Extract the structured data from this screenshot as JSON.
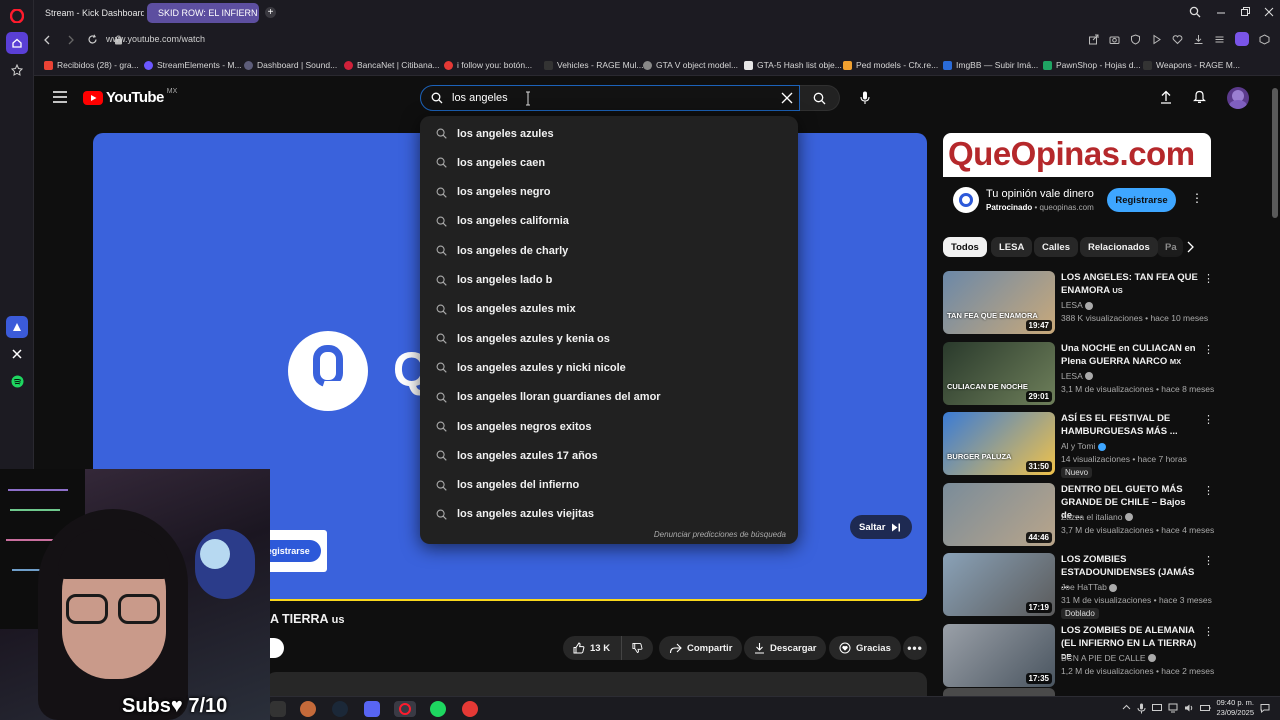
{
  "browser": {
    "tabs": [
      {
        "label": "Stream - Kick Dashboard",
        "active": false
      },
      {
        "label": "SKID ROW: EL INFIERN",
        "active": true
      }
    ],
    "url": "www.youtube.com/watch",
    "bookmarks": [
      "Recibidos (28) - gra...",
      "StreamElements - M...",
      "Dashboard | Sound...",
      "BancaNet | Citibana...",
      "i follow you: botón...",
      "Vehicles - RAGE Mul...",
      "GTA V object model...",
      "GTA-5 Hash list obje...",
      "Ped models - Cfx.re...",
      "ImgBB — Subir Imá...",
      "PawnShop - Hojas d...",
      "Weapons - RAGE M..."
    ]
  },
  "youtube": {
    "logo": "YouTube",
    "region": "MX",
    "search_value": "los angeles",
    "suggestions": [
      "los angeles azules",
      "los angeles caen",
      "los angeles negro",
      "los angeles california",
      "los angeles de charly",
      "los angeles lado b",
      "los angeles azules mix",
      "los angeles azules y kenia os",
      "los angeles azules y nicki nicole",
      "los angeles lloran guardianes del amor",
      "los angeles negros exitos",
      "los angeles azules 17 años",
      "los angeles del infierno",
      "los angeles azules viejitas"
    ],
    "report_predictions": "Denunciar predicciones de búsqueda"
  },
  "player": {
    "ad_logo_letter": "Q",
    "ad_register": "Registrarse",
    "skip_label": "Saltar",
    "video_title_partial": "A TIERRA",
    "video_title_region": "us"
  },
  "actions": {
    "likes": "13 K",
    "share": "Compartir",
    "download": "Descargar",
    "thanks": "Gracias"
  },
  "ad_card": {
    "banner_text": "QueOpinas.com",
    "headline": "Tu opinión vale dinero",
    "sponsored": "Patrocinado",
    "domain": "queopinas.com",
    "cta": "Registrarse"
  },
  "chips": [
    "Todos",
    "LESA",
    "Calles",
    "Relacionados",
    "Pa"
  ],
  "recommendations": [
    {
      "title": "LOS ANGELES: TAN FEA QUE ENAMORA",
      "region": "US",
      "channel": "LESA",
      "meta": "388 K visualizaciones • hace 10 meses",
      "duration": "19:47",
      "thumb_text": "TAN FEA QUE ENAMORA",
      "badge": ""
    },
    {
      "title": "Una NOCHE en CULIACAN en Plena GUERRA NARCO",
      "region": "MX",
      "channel": "LESA",
      "meta": "3,1 M de visualizaciones • hace 8 meses",
      "duration": "29:01",
      "thumb_text": "CULIACAN DE NOCHE",
      "badge": ""
    },
    {
      "title": "ASÍ ES EL FESTIVAL DE HAMBURGUESAS MÁS ...",
      "region": "",
      "channel": "Al y Tomi",
      "meta": "14 visualizaciones • hace 7 horas",
      "duration": "31:50",
      "thumb_text": "BURGER PALUZA",
      "badge": "Nuevo"
    },
    {
      "title": "DENTRO DEL GUETO MÁS GRANDE DE CHILE – Bajos de ...",
      "region": "",
      "channel": "Zazza el italiano",
      "meta": "3,7 M de visualizaciones • hace 4 meses",
      "duration": "44:46",
      "thumb_text": "",
      "badge": ""
    },
    {
      "title": "LOS ZOMBIES ESTADOUNIDENSES (JAMÁS ...",
      "region": "",
      "channel": "Joe HaTTab",
      "meta": "31 M de visualizaciones • hace 3 meses",
      "duration": "17:19",
      "thumb_text": "",
      "badge": "Doblado"
    },
    {
      "title": "LOS ZOMBIES DE ALEMANIA (EL INFIERNO EN LA TIERRA)",
      "region": "DE",
      "channel": "BCN A PIE DE CALLE",
      "meta": "1,2 M de visualizaciones • hace 2 meses",
      "duration": "17:35",
      "thumb_text": "",
      "badge": ""
    }
  ],
  "overlay": {
    "subs_text": "Subs♥ 7/10"
  },
  "taskbar": {
    "time": "09:40 p. m.",
    "date": "23/09/2025"
  },
  "colors": {
    "youtube_red": "#ff0000",
    "player_blue": "#3a62dc",
    "ad_banner_red": "#b5282b",
    "search_focus": "#1c62b9",
    "verified_teal": "#3ea6ff"
  }
}
